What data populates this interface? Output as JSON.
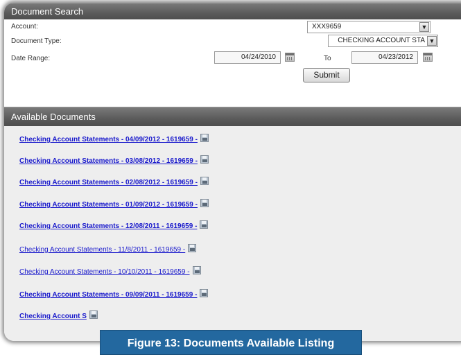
{
  "search": {
    "header": "Document Search",
    "account_label": "Account:",
    "account_value": "XXX9659",
    "doctype_label": "Document Type:",
    "doctype_value": "CHECKING ACCOUNT STA",
    "daterange_label": "Date Range:",
    "from_date": "04/24/2010",
    "to_label": "To",
    "to_date": "04/23/2012",
    "submit_label": "Submit"
  },
  "documents": {
    "header": "Available Documents",
    "items": [
      {
        "label": "Checking Account Statements - 04/09/2012 - 1619659 -",
        "bold": true
      },
      {
        "label": "Checking Account Statements - 03/08/2012 - 1619659 -",
        "bold": true
      },
      {
        "label": "Checking Account Statements - 02/08/2012 - 1619659 -",
        "bold": true
      },
      {
        "label": "Checking Account Statements - 01/09/2012 - 1619659 -",
        "bold": true
      },
      {
        "label": "Checking Account Statements - 12/08/2011 - 1619659 -",
        "bold": true
      },
      {
        "label": "Checking Account Statements - 11/8/2011 - 1619659 -",
        "bold": false
      },
      {
        "label": "Checking Account Statements - 10/10/2011 - 1619659 -",
        "bold": false
      },
      {
        "label": "Checking Account Statements - 09/09/2011 - 1619659 -",
        "bold": true
      },
      {
        "label": "Checking Account S",
        "bold": true
      }
    ]
  },
  "caption": "Figure 13: Documents Available Listing"
}
